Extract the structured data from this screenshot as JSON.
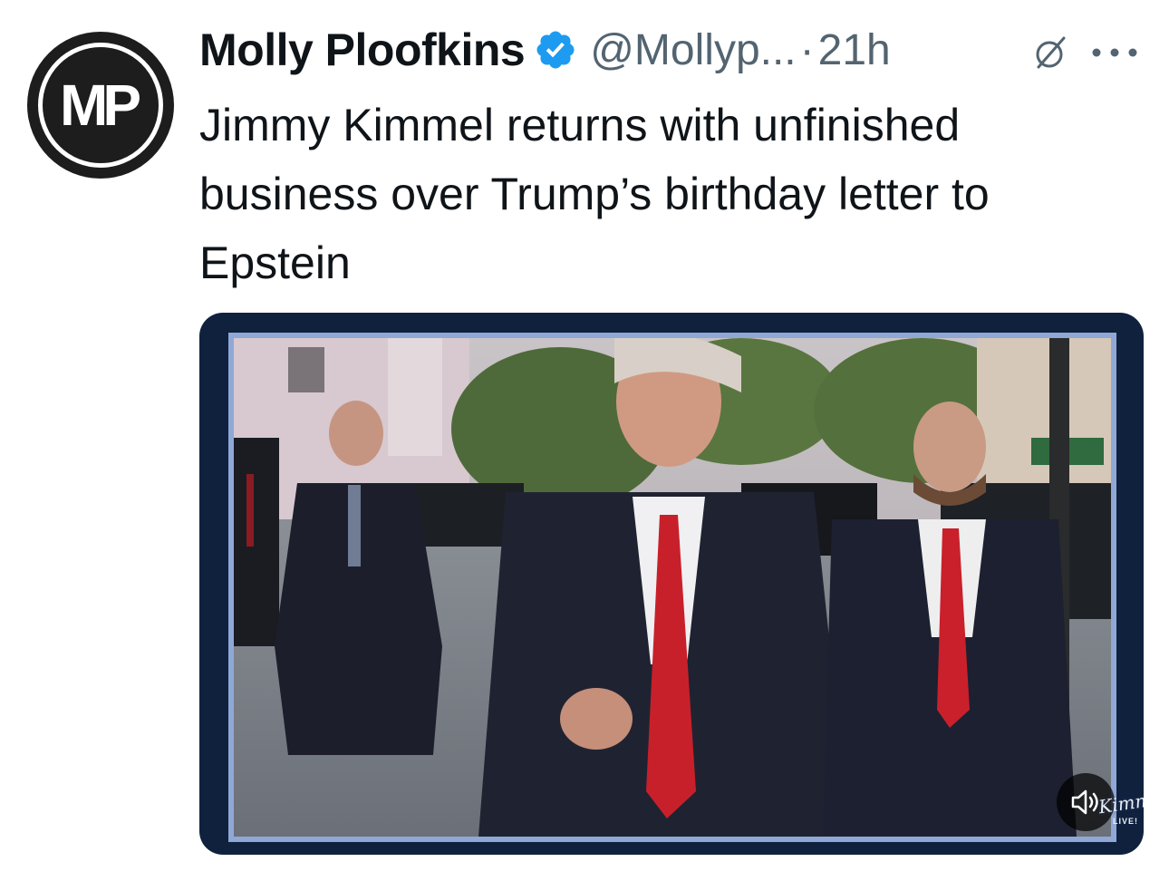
{
  "author": {
    "avatar_initials": "MP",
    "name": "Molly Ploofkins",
    "handle": "@Mollyp...",
    "separator": "·",
    "time": "21h",
    "verified_icon": "verified-badge-icon",
    "verified_color": "#1d9bf0"
  },
  "tweet": {
    "text": "Jimmy Kimmel returns with unfinished business over Trump’s birthday letter to Epstein"
  },
  "media": {
    "watermark": "Kimmel",
    "watermark_sub": "LIVE!",
    "sound_icon": "speaker-volume-icon"
  },
  "actions": {
    "grok_icon": "grok-icon",
    "more_icon": "more-options-icon"
  }
}
